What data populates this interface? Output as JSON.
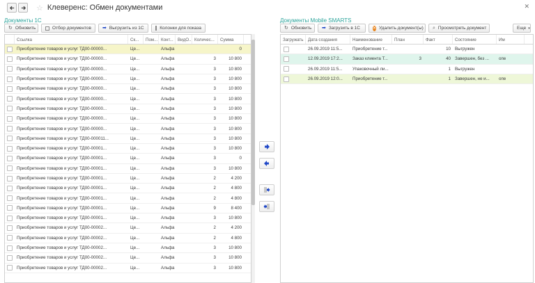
{
  "window": {
    "title": "Клеверенс: Обмен документами"
  },
  "left": {
    "section_title": "Документы 1С",
    "toolbar": {
      "refresh": "Обновить",
      "select_docs": "Отбор документов",
      "upload_1c": "Выгрузить из 1С",
      "columns": "Колонки для показа"
    },
    "columns": [
      "Ссылка",
      "Ск...",
      "Пом...",
      "Конт...",
      "ВидО...",
      "Количес...",
      "Сумма"
    ],
    "rows": [
      {
        "link": "Приобретение товаров и услуг ТД00-00000...",
        "sk": "Це...",
        "pom": "",
        "kont": "Альфа",
        "vid": "",
        "qty": "",
        "sum": "0"
      },
      {
        "link": "Приобретение товаров и услуг ТД00-00000...",
        "sk": "Це...",
        "pom": "",
        "kont": "Альфа",
        "vid": "",
        "qty": "3",
        "sum": "10 800"
      },
      {
        "link": "Приобретение товаров и услуг ТД00-00000...",
        "sk": "Це...",
        "pom": "",
        "kont": "Альфа",
        "vid": "",
        "qty": "3",
        "sum": "10 800"
      },
      {
        "link": "Приобретение товаров и услуг ТД00-00000...",
        "sk": "Це...",
        "pom": "",
        "kont": "Альфа",
        "vid": "",
        "qty": "3",
        "sum": "10 800"
      },
      {
        "link": "Приобретение товаров и услуг ТД00-00000...",
        "sk": "Це...",
        "pom": "",
        "kont": "Альфа",
        "vid": "",
        "qty": "3",
        "sum": "10 800"
      },
      {
        "link": "Приобретение товаров и услуг ТД00-00000...",
        "sk": "Це...",
        "pom": "",
        "kont": "Альфа",
        "vid": "",
        "qty": "3",
        "sum": "10 800"
      },
      {
        "link": "Приобретение товаров и услуг ТД00-00000...",
        "sk": "Це...",
        "pom": "",
        "kont": "Альфа",
        "vid": "",
        "qty": "3",
        "sum": "10 800"
      },
      {
        "link": "Приобретение товаров и услуг ТД00-00000...",
        "sk": "Це...",
        "pom": "",
        "kont": "Альфа",
        "vid": "",
        "qty": "3",
        "sum": "10 800"
      },
      {
        "link": "Приобретение товаров и услуг ТД00-00000...",
        "sk": "Це...",
        "pom": "",
        "kont": "Альфа",
        "vid": "",
        "qty": "3",
        "sum": "10 800"
      },
      {
        "link": "Приобретение товаров и услуг ТД00-000011...",
        "sk": "Це...",
        "pom": "",
        "kont": "Альфа",
        "vid": "",
        "qty": "3",
        "sum": "10 800"
      },
      {
        "link": "Приобретение товаров и услуг ТД00-00001...",
        "sk": "Це...",
        "pom": "",
        "kont": "Альфа",
        "vid": "",
        "qty": "3",
        "sum": "10 800"
      },
      {
        "link": "Приобретение товаров и услуг ТД00-00001...",
        "sk": "Це...",
        "pom": "",
        "kont": "Альфа",
        "vid": "",
        "qty": "3",
        "sum": "0"
      },
      {
        "link": "Приобретение товаров и услуг ТД00-00001...",
        "sk": "Це...",
        "pom": "",
        "kont": "Альфа",
        "vid": "",
        "qty": "3",
        "sum": "10 800"
      },
      {
        "link": "Приобретение товаров и услуг ТД00-00001...",
        "sk": "Це...",
        "pom": "",
        "kont": "Альфа",
        "vid": "",
        "qty": "2",
        "sum": "4 200"
      },
      {
        "link": "Приобретение товаров и услуг ТД00-00001...",
        "sk": "Це...",
        "pom": "",
        "kont": "Альфа",
        "vid": "",
        "qty": "2",
        "sum": "4 800"
      },
      {
        "link": "Приобретение товаров и услуг ТД00-00001...",
        "sk": "Це...",
        "pom": "",
        "kont": "Альфа",
        "vid": "",
        "qty": "2",
        "sum": "4 800"
      },
      {
        "link": "Приобретение товаров и услуг ТД00-00001...",
        "sk": "Це...",
        "pom": "",
        "kont": "Альфа",
        "vid": "",
        "qty": "9",
        "sum": "8 400"
      },
      {
        "link": "Приобретение товаров и услуг ТД00-00001...",
        "sk": "Це...",
        "pom": "",
        "kont": "Альфа",
        "vid": "",
        "qty": "3",
        "sum": "10 800"
      },
      {
        "link": "Приобретение товаров и услуг ТД00-00002...",
        "sk": "Це...",
        "pom": "",
        "kont": "Альфа",
        "vid": "",
        "qty": "2",
        "sum": "4 200"
      },
      {
        "link": "Приобретение товаров и услуг ТД00-00002...",
        "sk": "Це...",
        "pom": "",
        "kont": "Альфа",
        "vid": "",
        "qty": "2",
        "sum": "4 800"
      },
      {
        "link": "Приобретение товаров и услуг ТД00-00002...",
        "sk": "Це...",
        "pom": "",
        "kont": "Альфа",
        "vid": "",
        "qty": "3",
        "sum": "10 800"
      },
      {
        "link": "Приобретение товаров и услуг ТД00-00002...",
        "sk": "Це...",
        "pom": "",
        "kont": "Альфа",
        "vid": "",
        "qty": "3",
        "sum": "10 800"
      },
      {
        "link": "Приобретение товаров и услуг ТД00-00002...",
        "sk": "Це...",
        "pom": "",
        "kont": "Альфа",
        "vid": "",
        "qty": "3",
        "sum": "10 800"
      }
    ]
  },
  "right": {
    "section_title": "Документы Mobile SMARTS",
    "toolbar": {
      "refresh": "Обновить",
      "load_1c": "Загрузить в 1С",
      "delete_docs": "Удалить документ(ы)",
      "view_doc": "Просмотреть документ",
      "more": "Еще"
    },
    "columns": [
      "Загружать",
      "Дата создания",
      "Наименование",
      "План",
      "Факт",
      "Состояние",
      "Им"
    ],
    "rows": [
      {
        "date": "26.09.2019 11:5...",
        "name": "Приобретение т...",
        "plan": "",
        "fact": "10",
        "state": "Выгружен",
        "im": ""
      },
      {
        "date": "12.09.2019 17:2...",
        "name": "Заказ клиента Т...",
        "plan": "3",
        "fact": "40",
        "state": "Завершен, без ...",
        "im": "опе"
      },
      {
        "date": "26.09.2019 11:5...",
        "name": "Упаковочный ли...",
        "plan": "",
        "fact": "1",
        "state": "Выгружен",
        "im": ""
      },
      {
        "date": "26.09.2019 12:0...",
        "name": "Приобретение т...",
        "plan": "",
        "fact": "1",
        "state": "Завершен, не и...",
        "im": "опе"
      }
    ]
  }
}
